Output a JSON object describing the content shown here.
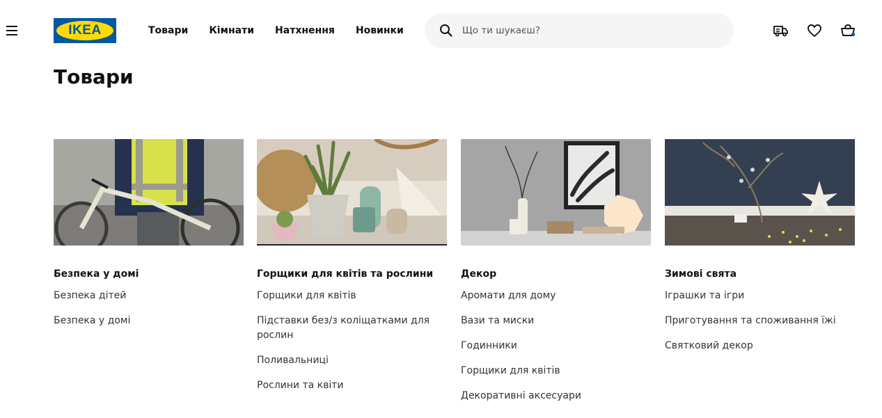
{
  "header": {
    "logo_text": "IKEA",
    "nav": [
      "Товари",
      "Кімнати",
      "Натхнення",
      "Новинки"
    ],
    "search": {
      "placeholder": "Що ти шукаєш?"
    },
    "icons": [
      "menu-icon",
      "search-icon",
      "delivery-truck-icon",
      "heart-icon",
      "shopping-bag-icon"
    ],
    "colors": {
      "brand_blue": "#0058a3",
      "brand_yellow": "#ffdb00",
      "cart_dot": "#0058a3"
    }
  },
  "page": {
    "title": "Товари"
  },
  "categories": [
    {
      "title": "Безпека у домі",
      "links": [
        "Безпека дітей",
        "Безпека у домі"
      ]
    },
    {
      "title": "Горщики для квітів та рослини",
      "links": [
        "Горщики для квітів",
        "Підставки без/з коліщатками для рослин",
        "Поливальниці",
        "Рослини та квіти"
      ]
    },
    {
      "title": "Декор",
      "links": [
        "Аромати для дому",
        "Вази та миски",
        "Годинники",
        "Горщики для квітів",
        "Декоративні аксесуари"
      ]
    },
    {
      "title": "Зимові свята",
      "links": [
        "Іграшки та ігри",
        "Приготування та споживання їжі",
        "Святковий декор"
      ]
    }
  ]
}
